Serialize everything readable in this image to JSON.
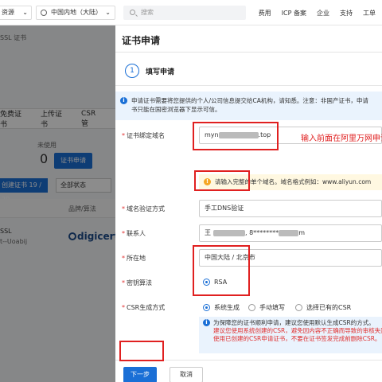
{
  "topbar": {
    "resource_label": "资源",
    "region_label": "中国内地（大陆）",
    "search_placeholder": "搜索",
    "links": [
      "费用",
      "ICP 备案",
      "企业",
      "支持",
      "工单"
    ]
  },
  "background": {
    "breadcrumb": "SSL 证书",
    "tabs": [
      "免费证书",
      "上传证书",
      "CSR管"
    ],
    "unused_label": "未使用",
    "unused_count": "0",
    "apply_button": "证书申请",
    "create_button": "创建证书 19 / 20",
    "status_select": "全部状态",
    "column_brand": "品牌/算法",
    "row_name": "SSL",
    "row_sub": "t--Uoabij",
    "brand_logo": "digicert"
  },
  "drawer": {
    "title": "证书申请",
    "step_number": "1",
    "step_label": "填写申请",
    "notice_line1": "申请证书需要将您提供的个人/公司信息提交给CA机构，请知悉。注意：非国产证书，申请",
    "notice_line2": "书只能在国密浏览器下显示可信。",
    "domain_label": "证书绑定域名",
    "domain_prefix": "myn",
    "domain_suffix": ".top",
    "domain_warning": "请输入完整的单个域名。域名格式例如：www.aliyun.com",
    "verify_label": "域名验证方式",
    "verify_value": "手工DNS验证",
    "contact_label": "联系人",
    "contact_prefix": "王",
    "contact_mid": ", 8********",
    "contact_suffix": "m",
    "location_label": "所在地",
    "location_value": "中国大陆 / 北京市",
    "algo_label": "密钥算法",
    "algo_option": "RSA",
    "csr_label": "CSR生成方式",
    "csr_options": [
      "系统生成",
      "手动填写",
      "选择已有的CSR"
    ],
    "csr_note1": "为保障您的证书顺利申请，建议您使用默认生成CSR的方式。",
    "csr_note2": "建议您使用系统创建的CSR，避免因内容不正确而导致的审核失败",
    "csr_note3": "使用已创建的CSR申请证书，不要在证书签发完成前删除CSR。",
    "next_button": "下一步",
    "cancel_button": "取消"
  },
  "annotation": {
    "text": "输入前面在阿里万网申请"
  },
  "colors": {
    "primary": "#1a6fd6",
    "annotation_red": "#e02020",
    "notice_bg": "#eaf3fd",
    "warning_bg": "#fff8e1"
  }
}
